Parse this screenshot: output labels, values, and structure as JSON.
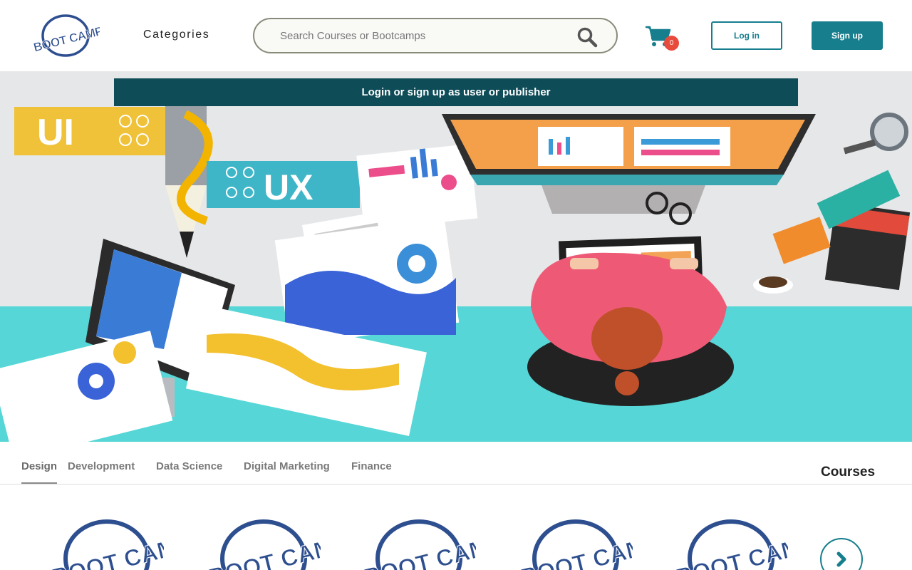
{
  "header": {
    "logo_text": "BOOT CAMP",
    "categories_label": "Categories",
    "search_placeholder": "Search Courses or Bootcamps",
    "cart_count": "0",
    "login_label": "Log in",
    "signup_label": "Sign up"
  },
  "banner": {
    "text": "Login or sign up as user or publisher",
    "illustration": {
      "ui_label": "UI",
      "ux_label": "UX"
    }
  },
  "tabs": [
    {
      "label": "Design",
      "active": true
    },
    {
      "label": "Development",
      "active": false
    },
    {
      "label": "Data Science",
      "active": false
    },
    {
      "label": "Digital Marketing",
      "active": false
    },
    {
      "label": "Finance",
      "active": false
    }
  ],
  "courses_heading": "Courses",
  "course_cards": [
    {
      "logo_text": "BOOT CAMP"
    },
    {
      "logo_text": "BOOT CAMP"
    },
    {
      "logo_text": "BOOT CAMP"
    },
    {
      "logo_text": "BOOT CAMP"
    },
    {
      "logo_text": "BOOT CAMP"
    }
  ],
  "colors": {
    "accent": "#177e8e",
    "banner_bar": "#0e4c58",
    "badge": "#e84b3c",
    "logo_blue": "#2e4f8f"
  },
  "icons": {
    "search": "search-icon",
    "cart": "cart-icon",
    "next": "chevron-right-icon"
  }
}
